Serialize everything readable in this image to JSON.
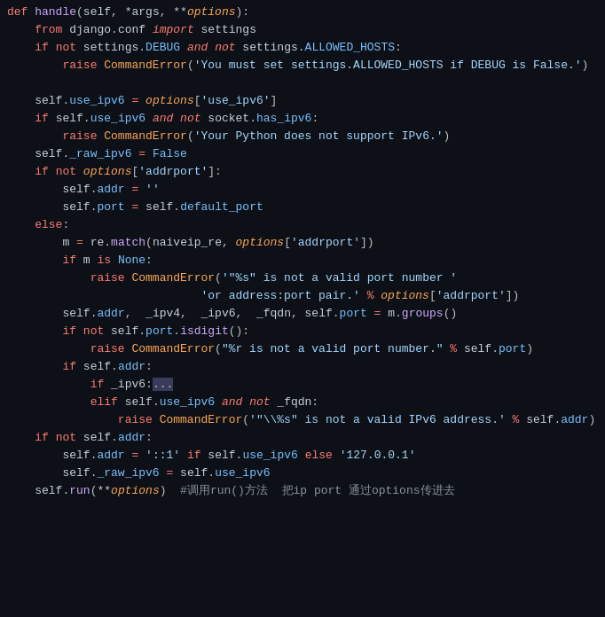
{
  "code": {
    "lines": [
      {
        "id": 1,
        "text": "def handle(self, *args, **options):"
      },
      {
        "id": 2,
        "text": "    from django.conf import settings"
      },
      {
        "id": 3,
        "text": "    if not settings.DEBUG and not settings.ALLOWED_HOSTS:"
      },
      {
        "id": 4,
        "text": "        raise CommandError('You must set settings.ALLOWED_HOSTS if DEBUG is False.')"
      },
      {
        "id": 5,
        "text": ""
      },
      {
        "id": 6,
        "text": "    self.use_ipv6 = options['use_ipv6']"
      },
      {
        "id": 7,
        "text": "    if self.use_ipv6 and not socket.has_ipv6:"
      },
      {
        "id": 8,
        "text": "        raise CommandError('Your Python does not support IPv6.')"
      },
      {
        "id": 9,
        "text": "    self._raw_ipv6 = False"
      },
      {
        "id": 10,
        "text": "    if not options['addrport']:"
      },
      {
        "id": 11,
        "text": "        self.addr = ''"
      },
      {
        "id": 12,
        "text": "        self.port = self.default_port"
      },
      {
        "id": 13,
        "text": "    else:"
      },
      {
        "id": 14,
        "text": "        m = re.match(naiveip_re, options['addrport'])"
      },
      {
        "id": 15,
        "text": "        if m is None:"
      },
      {
        "id": 16,
        "text": "            raise CommandError('\"%s\" is not a valid port number '"
      },
      {
        "id": 17,
        "text": "                            'or address:port pair.' % options['addrport'])"
      },
      {
        "id": 18,
        "text": "        self.addr, _ipv4, _ipv6, _fqdn, self.port = m.groups()"
      },
      {
        "id": 19,
        "text": "        if not self.port.isdigit():"
      },
      {
        "id": 20,
        "text": "            raise CommandError(\"%r is not a valid port number.\" % self.port)"
      },
      {
        "id": 21,
        "text": "        if self.addr:"
      },
      {
        "id": 22,
        "text": "            if _ipv6:..."
      },
      {
        "id": 23,
        "text": "            elif self.use_ipv6 and not _fqdn:"
      },
      {
        "id": 24,
        "text": "                raise CommandError('\"\\%s\" is not a valid IPv6 address.' % self.addr)"
      },
      {
        "id": 25,
        "text": "    if not self.addr:"
      },
      {
        "id": 26,
        "text": "        self.addr = '::1' if self.use_ipv6 else '127.0.0.1'"
      },
      {
        "id": 27,
        "text": "        self._raw_ipv6 = self.use_ipv6"
      },
      {
        "id": 28,
        "text": "    self.run(**options)  #调用run()方法  把ip port 通过options传进去"
      }
    ]
  }
}
